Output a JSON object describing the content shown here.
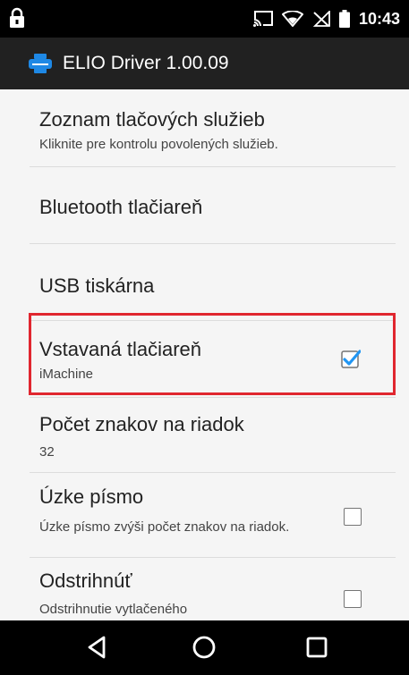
{
  "status_bar": {
    "time": "10:43",
    "icons": [
      "lock-icon",
      "cast-icon",
      "wifi-icon",
      "no-sim-icon",
      "battery-icon"
    ]
  },
  "app_bar": {
    "title": "ELIO Driver 1.00.09",
    "icon": "printer-icon",
    "accent_color": "#1e88e5"
  },
  "settings": [
    {
      "title": "Zoznam tlačových služieb",
      "subtitle": "Kliknite pre kontrolu povolených služieb."
    },
    {
      "title": "Bluetooth tlačiareň"
    },
    {
      "title": "USB tiskárna"
    },
    {
      "title": "Vstavaná tlačiareň",
      "subtitle": "iMachine",
      "checked": true,
      "highlighted": true
    },
    {
      "title": "Počet znakov na riadok",
      "subtitle": "32"
    },
    {
      "title": "Úzke písmo",
      "subtitle": "Úzke písmo zvýši počet znakov na riadok.",
      "checked": false
    },
    {
      "title": "Odstrihnúť",
      "subtitle": "Odstrihnutie vytlačeného",
      "checked": false
    }
  ],
  "highlight_color": "#e0262f",
  "checkbox_color": "#2196f3",
  "nav_bar": {
    "icons": [
      "back-icon",
      "home-icon",
      "recents-icon"
    ]
  }
}
